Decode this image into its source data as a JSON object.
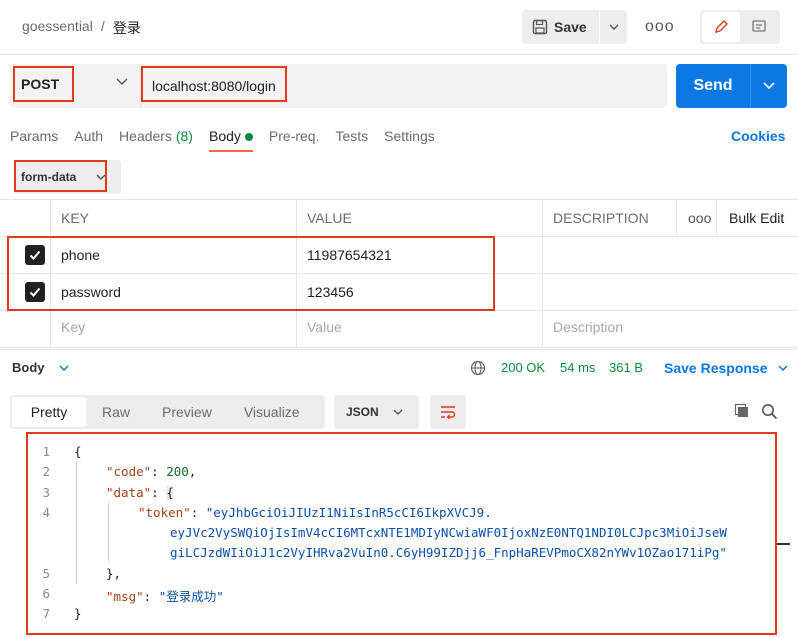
{
  "header": {
    "breadcrumb_parent": "goessential",
    "breadcrumb_sep": "/",
    "breadcrumb_current": "登录",
    "save_label": "Save",
    "more_label": "ooo"
  },
  "request": {
    "method": "POST",
    "url": "localhost:8080/login",
    "send_label": "Send"
  },
  "tabs": [
    {
      "label": "Params"
    },
    {
      "label": "Auth"
    },
    {
      "label": "Headers",
      "count": "(8)"
    },
    {
      "label": "Body"
    },
    {
      "label": "Pre-req."
    },
    {
      "label": "Tests"
    },
    {
      "label": "Settings"
    }
  ],
  "cookies_label": "Cookies",
  "body_type": "form-data",
  "table": {
    "headers": {
      "key": "KEY",
      "value": "VALUE",
      "description": "DESCRIPTION",
      "more": "ooo",
      "bulk": "Bulk Edit"
    },
    "rows": [
      {
        "key": "phone",
        "value": "11987654321",
        "checked": true
      },
      {
        "key": "password",
        "value": "123456",
        "checked": true
      }
    ],
    "placeholders": {
      "key": "Key",
      "value": "Value",
      "description": "Description"
    }
  },
  "response": {
    "section_label": "Body",
    "status": "200 OK",
    "time": "54 ms",
    "size": "361 B",
    "save_label": "Save Response",
    "views": [
      "Pretty",
      "Raw",
      "Preview",
      "Visualize"
    ],
    "active_view": "Pretty",
    "format": "JSON"
  },
  "code": {
    "line_numbers": [
      "1",
      "2",
      "3",
      "4",
      "5",
      "6",
      "7"
    ],
    "brace_open": "{",
    "code_key": "\"code\"",
    "code_val": "200",
    "data_key": "\"data\"",
    "data_open": "{",
    "token_key": "\"token\"",
    "token_part1": "\"eyJhbGciOiJIUzI1NiIsInR5cCI6IkpXVCJ9.",
    "token_part2": "eyJVc2VySWQiOjIsImV4cCI6MTcxNTE1MDIyNCwiaWF0IjoxNzE0NTQ1NDI0LCJpc3MiOiJseW",
    "token_part3": "giLCJzdWIiOiJ1c2VyIHRva2VuIn0.C6yH99IZDjj6_FnpHaREVPmoCX82nYWv1OZao171iPg\"",
    "data_close": "},",
    "msg_key": "\"msg\"",
    "msg_val": "\"登录成功\"",
    "brace_close": "}"
  },
  "colors": {
    "accent": "#0b78e3",
    "success": "#0c8b3c",
    "highlight": "#e5391e",
    "active_tab": "#f26b3a"
  }
}
